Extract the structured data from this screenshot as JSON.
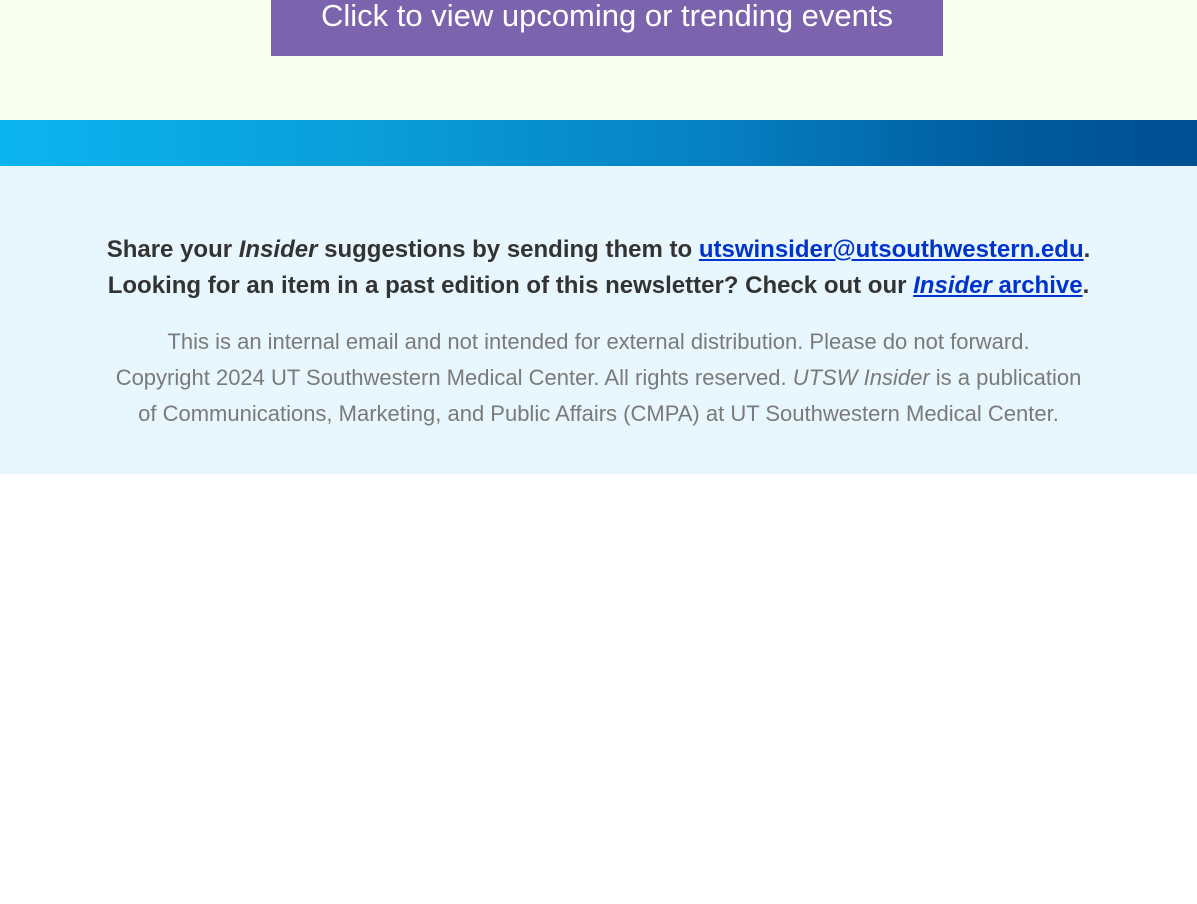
{
  "events_cta": {
    "label": "Click to view upcoming or trending events",
    "button_color": "#7b63ad",
    "band_color": "#fbffef"
  },
  "divider": {
    "gradient_start": "#0bb4ee",
    "gradient_end": "#004f93"
  },
  "footer": {
    "background": "#e8f7fd",
    "suggest_line1_part1": "Share your ",
    "suggest_line1_insider": "Insider",
    "suggest_line1_part2": " suggestions by sending them to ",
    "email_link": "utswinsider@utsouthwestern.edu",
    "suggest_line1_end": ".",
    "suggest_line2_part1": "Looking for an item in a past edition of this newsletter? Check out our ",
    "archive_link_italic": "Insider",
    "archive_link_rest": " archive",
    "suggest_line2_end": ".",
    "legal_line1": "This is an internal email and not intended for external distribution. Please do not forward.",
    "legal_line2_part1": "Copyright 2024 UT Southwestern Medical Center. All rights reserved. ",
    "legal_line2_publication": "UTSW Insider",
    "legal_line2_part2": " is a publication",
    "legal_line3": "of Communications, Marketing, and Public Affairs (CMPA) at UT Southwestern Medical Center.",
    "link_color": "#0033cc"
  }
}
